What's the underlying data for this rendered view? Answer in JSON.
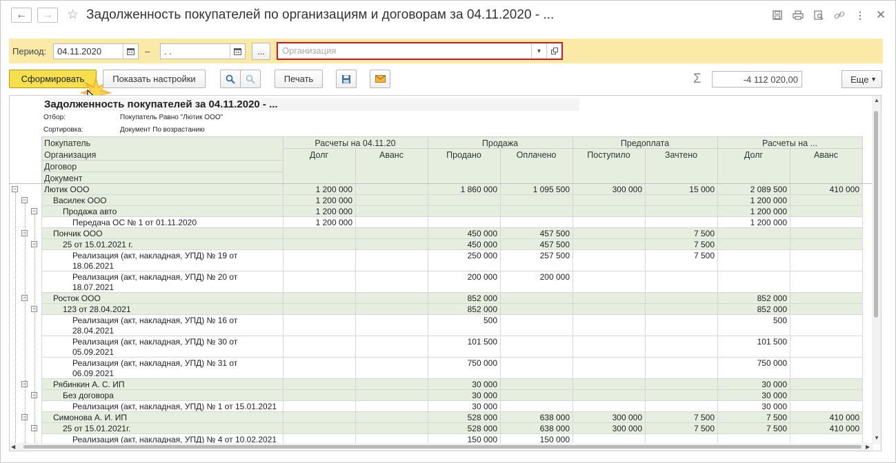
{
  "window": {
    "title": "Задолженность покупателей по организациям и договорам за 04.11.2020 - ..."
  },
  "icons": {
    "back": "arrow-left-icon",
    "forward": "arrow-right-icon",
    "favorite": "star-icon",
    "save": "save-icon",
    "print": "print-icon",
    "preview": "preview-icon",
    "link": "link-icon",
    "more": "more-vertical-icon",
    "close": "close-icon",
    "sum": "sigma-icon"
  },
  "filter": {
    "period_label": "Период:",
    "date_from": "04.11.2020",
    "dash": "–",
    "date_to": " .  . ",
    "dots": "...",
    "org_placeholder": "Организация"
  },
  "toolbar": {
    "generate": "Сформировать",
    "settings": "Показать настройки",
    "print": "Печать",
    "sum_value": "-4 112 020,00",
    "more": "Еще"
  },
  "report": {
    "title": "Задолженность покупателей за 04.11.2020 - ...",
    "filter_label": "Отбор:",
    "filter_value": "Покупатель Равно \"Лютик ООО\"",
    "sort_label": "Сортировка:",
    "sort_value": "Документ По возрастанию",
    "header": {
      "c1": "Покупатель",
      "c2": "Организация",
      "c3": "Договор",
      "c4": "Документ",
      "g1": "Расчеты на 04.11.20",
      "g2": "Продажа",
      "g3": "Предоплата",
      "g4": "Расчеты на ...",
      "s1": "Долг",
      "s2": "Аванс",
      "s3": "Продано",
      "s4": "Оплачено",
      "s5": "Поступило",
      "s6": "Зачтено",
      "s7": "Долг",
      "s8": "Аванс"
    },
    "rows": [
      {
        "level": 0,
        "name": "Лютик ООО",
        "v": [
          "1 200 000",
          "",
          "1 860 000",
          "1 095 500",
          "300 000",
          "15 000",
          "2 089 500",
          "410 000"
        ]
      },
      {
        "level": 1,
        "name": "Василек ООО",
        "v": [
          "1 200 000",
          "",
          "",
          "",
          "",
          "",
          "1 200 000",
          ""
        ]
      },
      {
        "level": 2,
        "name": "Продажа авто",
        "v": [
          "1 200 000",
          "",
          "",
          "",
          "",
          "",
          "1 200 000",
          ""
        ]
      },
      {
        "level": 3,
        "name": "Передача ОС № 1 от 01.11.2020",
        "v": [
          "1 200 000",
          "",
          "",
          "",
          "",
          "",
          "1 200 000",
          ""
        ]
      },
      {
        "level": 1,
        "name": "Пончик ООО",
        "v": [
          "",
          "",
          "450 000",
          "457 500",
          "",
          "7 500",
          "",
          ""
        ]
      },
      {
        "level": 2,
        "name": "25 от 15.01.2021 г.",
        "v": [
          "",
          "",
          "450 000",
          "457 500",
          "",
          "7 500",
          "",
          ""
        ]
      },
      {
        "level": 3,
        "name": "Реализация (акт, накладная, УПД) № 19 от",
        "name2": "18.06.2021",
        "v": [
          "",
          "",
          "250 000",
          "257 500",
          "",
          "7 500",
          "",
          ""
        ]
      },
      {
        "level": 3,
        "name": "Реализация (акт, накладная, УПД) № 20 от",
        "name2": "18.07.2021",
        "v": [
          "",
          "",
          "200 000",
          "200 000",
          "",
          "",
          "",
          ""
        ]
      },
      {
        "level": 1,
        "name": "Росток ООО",
        "v": [
          "",
          "",
          "852 000",
          "",
          "",
          "",
          "852 000",
          ""
        ]
      },
      {
        "level": 2,
        "name": "123 от 28.04.2021",
        "v": [
          "",
          "",
          "852 000",
          "",
          "",
          "",
          "852 000",
          ""
        ]
      },
      {
        "level": 3,
        "name": "Реализация (акт, накладная, УПД) № 16 от",
        "name2": "28.04.2021",
        "v": [
          "",
          "",
          "500",
          "",
          "",
          "",
          "500",
          ""
        ]
      },
      {
        "level": 3,
        "name": "Реализация (акт, накладная, УПД) № 30 от",
        "name2": "05.09.2021",
        "v": [
          "",
          "",
          "101 500",
          "",
          "",
          "",
          "101 500",
          ""
        ]
      },
      {
        "level": 3,
        "name": "Реализация (акт, накладная, УПД) № 31 от",
        "name2": "06.09.2021",
        "v": [
          "",
          "",
          "750 000",
          "",
          "",
          "",
          "750 000",
          ""
        ]
      },
      {
        "level": 1,
        "name": "Рябинкин А. С. ИП",
        "v": [
          "",
          "",
          "30 000",
          "",
          "",
          "",
          "30 000",
          ""
        ]
      },
      {
        "level": 2,
        "name": "Без договора",
        "v": [
          "",
          "",
          "30 000",
          "",
          "",
          "",
          "30 000",
          ""
        ]
      },
      {
        "level": 3,
        "name": "Реализация (акт, накладная, УПД) № 1 от 15.01.2021",
        "v": [
          "",
          "",
          "30 000",
          "",
          "",
          "",
          "30 000",
          ""
        ]
      },
      {
        "level": 1,
        "name": "Симонова А. И. ИП",
        "v": [
          "",
          "",
          "528 000",
          "638 000",
          "300 000",
          "7 500",
          "7 500",
          "410 000"
        ]
      },
      {
        "level": 2,
        "name": "25 от 15.01.2021г.",
        "v": [
          "",
          "",
          "528 000",
          "638 000",
          "300 000",
          "7 500",
          "7 500",
          "410 000"
        ]
      },
      {
        "level": 3,
        "name": "Реализация (акт, накладная, УПД) № 4 от 10.02.2021",
        "v": [
          "",
          "",
          "150 000",
          "150 000",
          "",
          "",
          "",
          ""
        ]
      }
    ]
  },
  "colors": {
    "accent": "#f5df4d",
    "filter_bg": "#faeaa7",
    "group_bg": "#e6efdf",
    "highlight_border": "#d8141d"
  }
}
